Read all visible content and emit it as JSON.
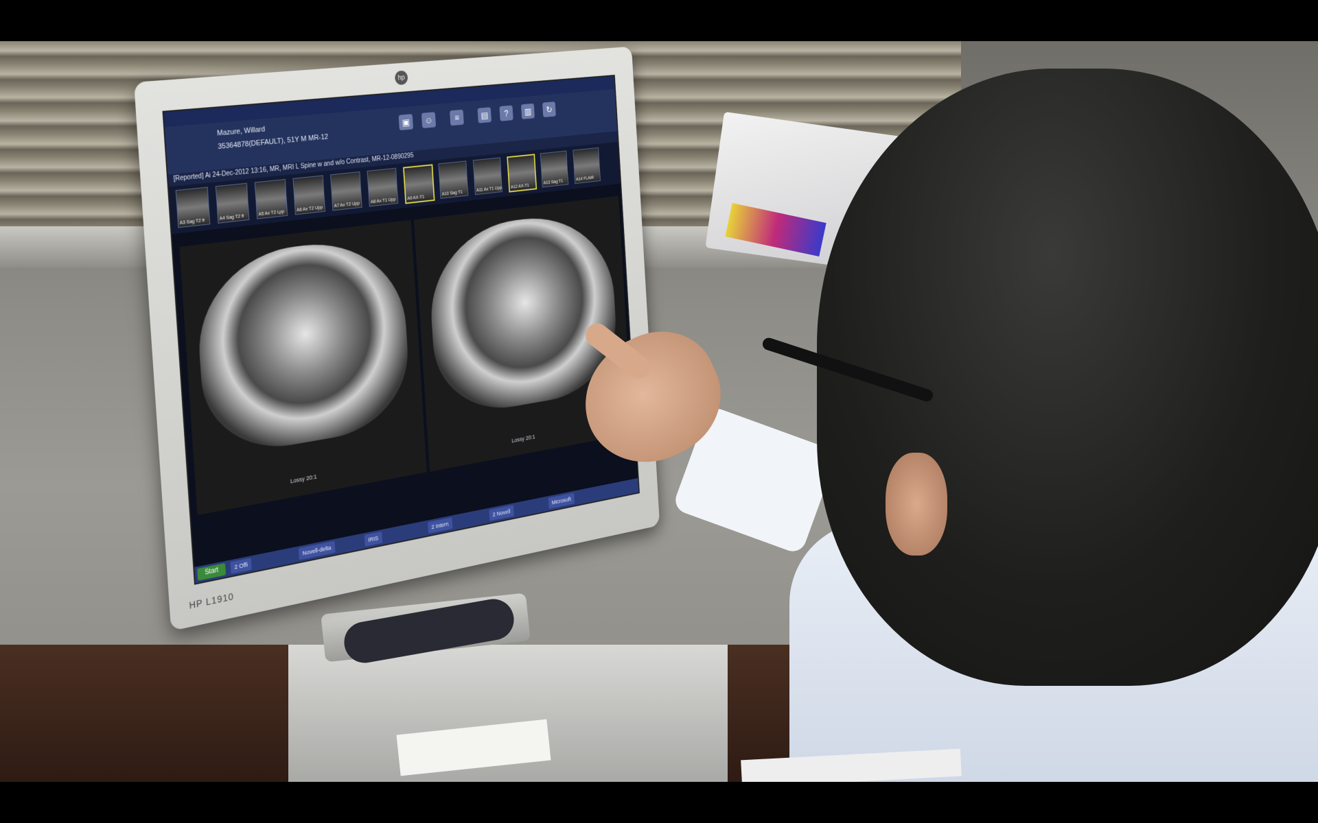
{
  "monitor": {
    "brand_logo": "hp",
    "model_label": "HP L1910"
  },
  "viewer": {
    "patient_name": "Mazure, Willard",
    "patient_id": "35364878(DEFAULT), 51Y M MR-12",
    "study_line": "[Reported] Ai 24-Dec-2012 13:16, MR, MRI L Spine w and w/o Contrast, MR-12-0890295",
    "thumbnails": [
      {
        "label": "A3 Sag T2 fr",
        "selected": false
      },
      {
        "label": "A4 Sag T2 fr",
        "selected": false
      },
      {
        "label": "A5 Ax T2 Lpp",
        "selected": false
      },
      {
        "label": "A6 Ax T2 Upp",
        "selected": false
      },
      {
        "label": "A7 Ax T2 Upp",
        "selected": false
      },
      {
        "label": "A8 Ax T1 Upp",
        "selected": false
      },
      {
        "label": "A9 AX-T1",
        "selected": true
      },
      {
        "label": "A10 Sag T1",
        "selected": false
      },
      {
        "label": "A11 Ax T1 Upp",
        "selected": false
      },
      {
        "label": "A12 AX-T1",
        "selected": true
      },
      {
        "label": "A13 Sag T1",
        "selected": false
      },
      {
        "label": "A14 FLAIR",
        "selected": false
      }
    ],
    "viewport_left_label": "Lossy 20:1",
    "viewport_right_label": "Lossy 20:1",
    "taskbar": {
      "start": "Start",
      "items": [
        "2 Offi",
        "Novell-delta",
        "IRIS",
        "2 Intern",
        "2 Novell",
        "Microsoft"
      ]
    }
  }
}
